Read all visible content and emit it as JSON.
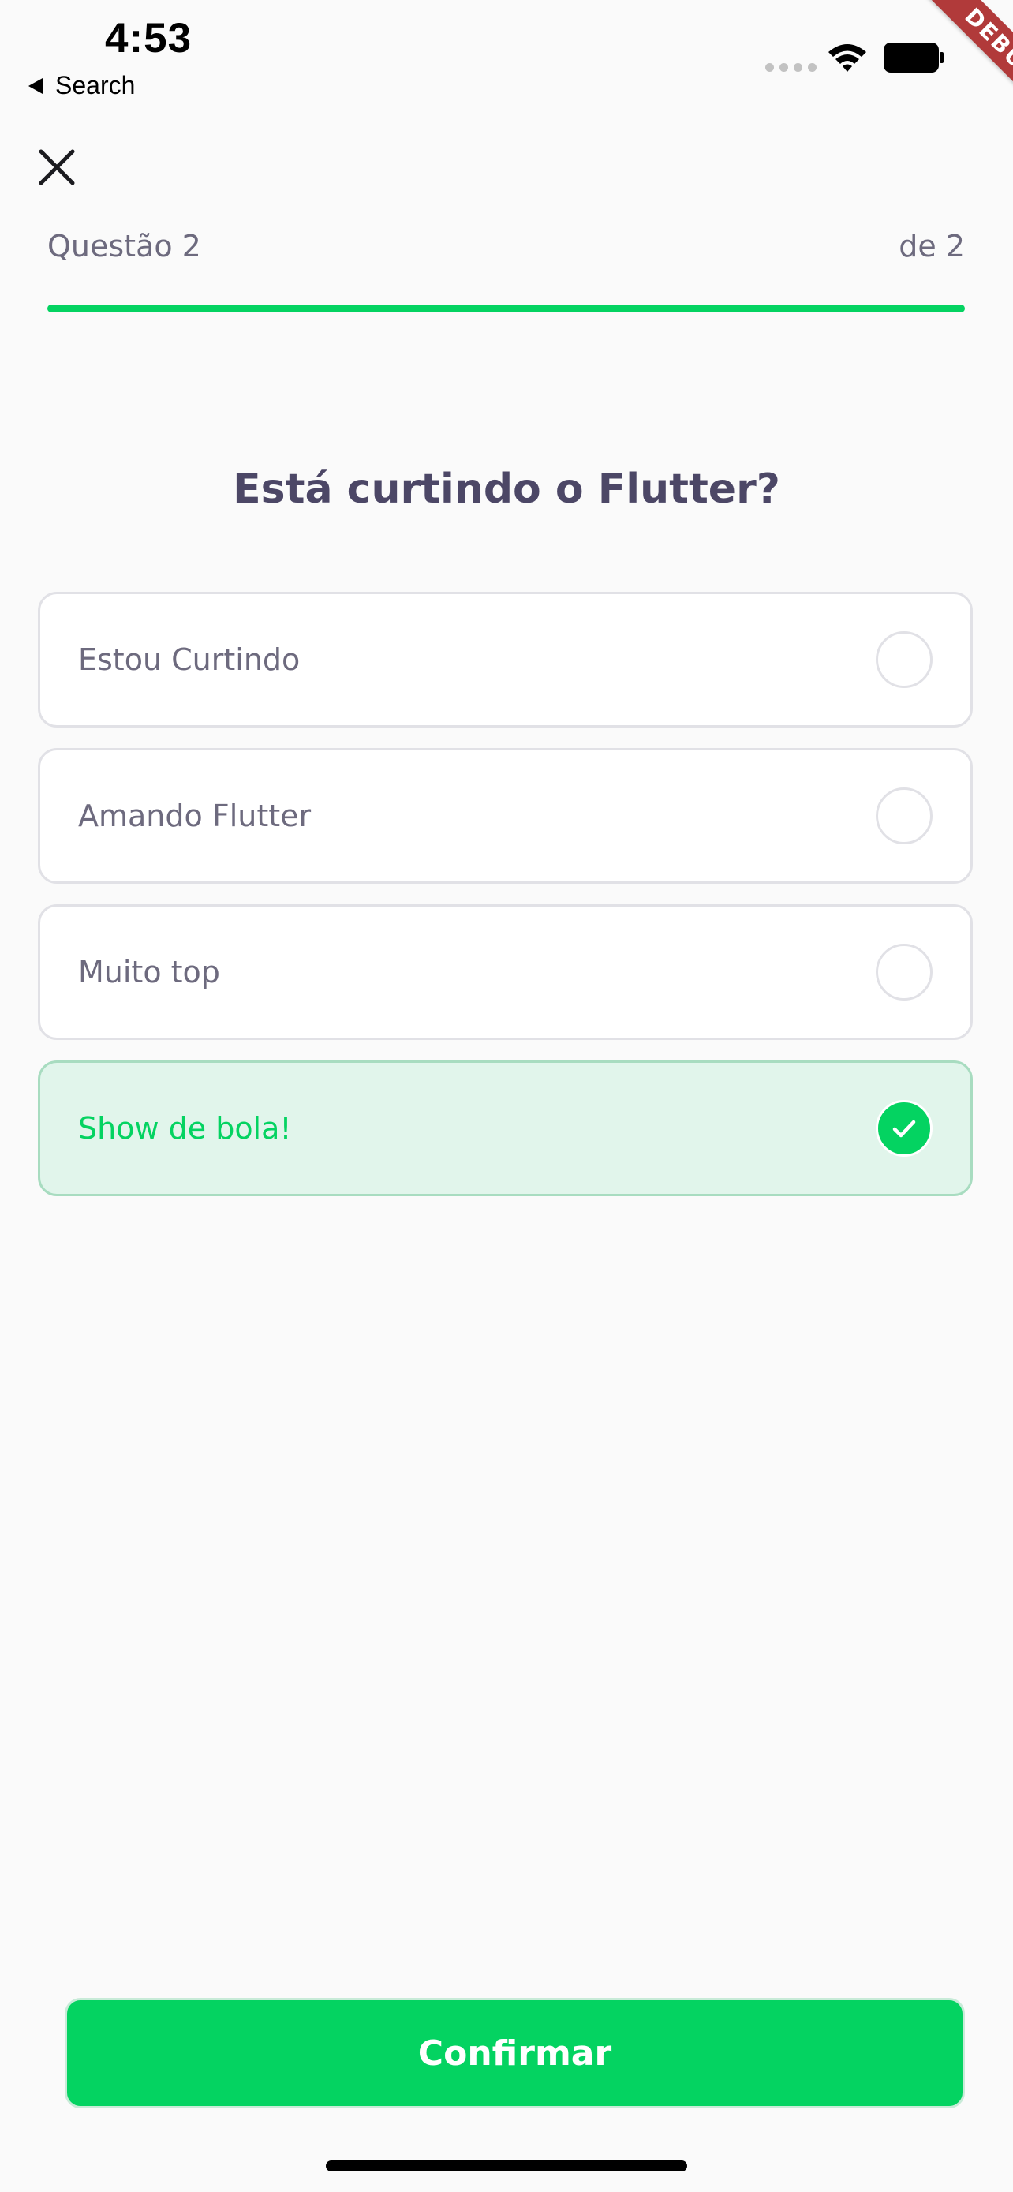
{
  "status_bar": {
    "time": "4:53",
    "back_label": "Search"
  },
  "debug_banner": "DEBUG",
  "quiz": {
    "question_label": "Questão 2",
    "question_total": "de 2",
    "progress": 1.0,
    "question": "Está curtindo o Flutter?",
    "answers": [
      {
        "label": "Estou Curtindo",
        "selected": false
      },
      {
        "label": "Amando Flutter",
        "selected": false
      },
      {
        "label": "Muito top",
        "selected": false
      },
      {
        "label": "Show de bola!",
        "selected": true
      }
    ],
    "confirm_label": "Confirmar"
  },
  "colors": {
    "accent": "#04D361",
    "title": "#4C4766",
    "text": "#6D6A7E",
    "selected_bg": "#E1F5EB",
    "border": "#E1E1E6"
  }
}
